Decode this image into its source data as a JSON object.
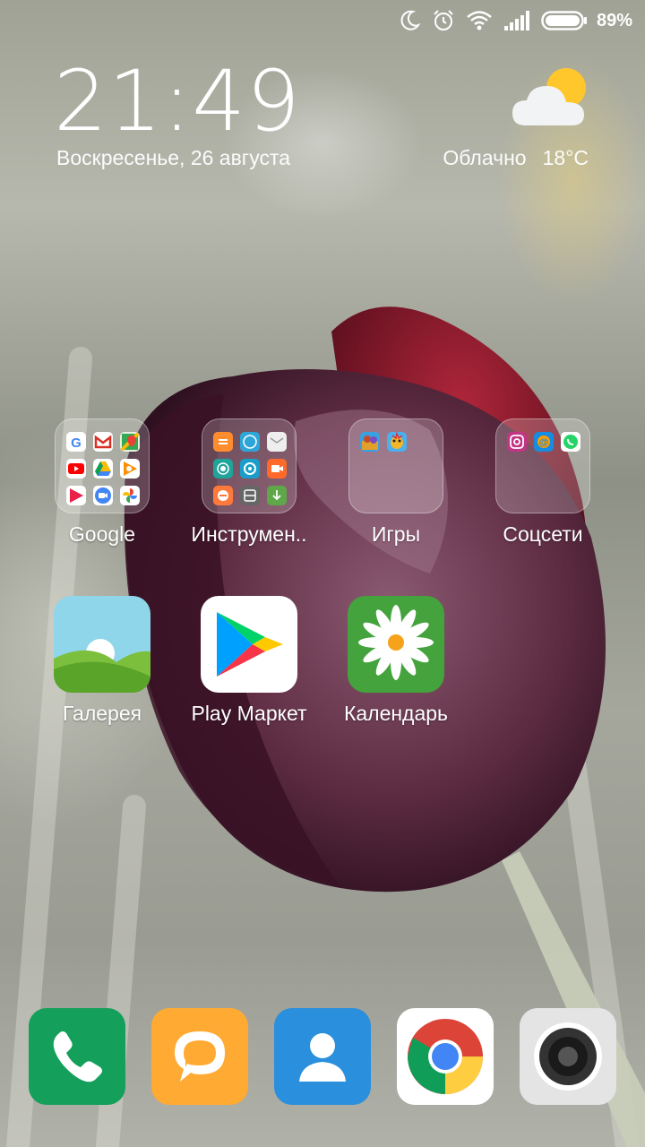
{
  "status_bar": {
    "icons": [
      "moon-icon",
      "alarm-icon",
      "wifi-icon",
      "signal-icon",
      "battery-icon"
    ],
    "battery_percent": "89%"
  },
  "clock_widget": {
    "time": "21:49",
    "date": "Воскресенье, 26 августа"
  },
  "weather_widget": {
    "icon": "partly-cloudy-icon",
    "condition": "Облачно",
    "temperature": "18°C"
  },
  "folders": [
    {
      "label": "Google",
      "icons": [
        "google-icon",
        "gmail-icon",
        "maps-icon",
        "youtube-icon",
        "drive-icon",
        "play-music-icon",
        "play-movies-icon",
        "duo-icon",
        "photos-icon"
      ]
    },
    {
      "label": "Инструмен..",
      "icons": [
        "notes-icon",
        "clock-icon",
        "mail-icon",
        "radio-icon",
        "compass-icon",
        "screen-recorder-icon",
        "feedback-icon",
        "scanner-icon",
        "downloads-icon"
      ]
    },
    {
      "label": "Игры",
      "icons": [
        "game-1-icon",
        "game-2-icon"
      ]
    },
    {
      "label": "Соцсети",
      "icons": [
        "instagram-icon",
        "mail-ru-icon",
        "whatsapp-icon"
      ]
    }
  ],
  "apps": [
    {
      "label": "Галерея",
      "icon": "gallery-icon"
    },
    {
      "label": "Play Маркет",
      "icon": "play-store-icon"
    },
    {
      "label": "Календарь",
      "icon": "calendar-icon"
    }
  ],
  "dock": [
    {
      "icon": "phone-icon"
    },
    {
      "icon": "messages-icon"
    },
    {
      "icon": "contacts-icon"
    },
    {
      "icon": "chrome-icon"
    },
    {
      "icon": "camera-icon"
    }
  ],
  "colors": {
    "phone": "#14a05a",
    "messages": "#ffaa33",
    "contacts": "#2a8fdc",
    "calendar": "#44a33c",
    "tulip": "#5c2a3c"
  }
}
